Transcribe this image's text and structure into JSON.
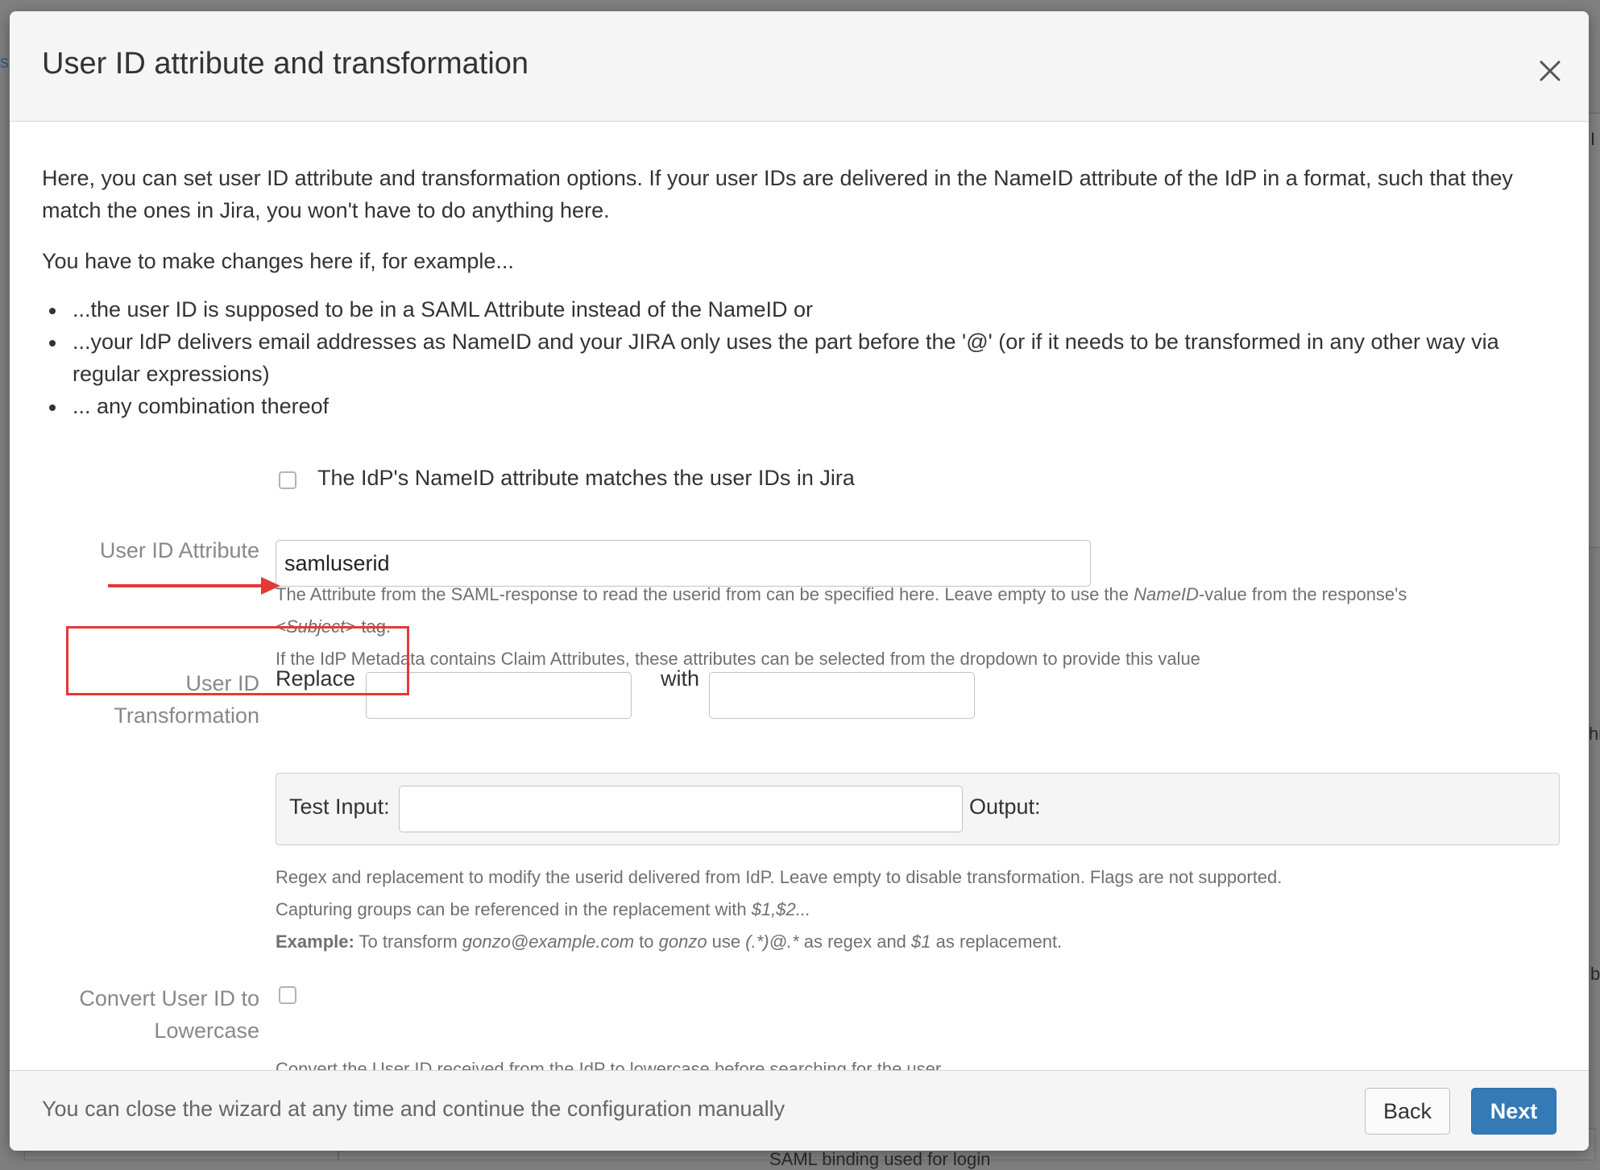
{
  "background": {
    "snippets": [
      "s",
      "I",
      "hi",
      "b",
      "SAML binding used for login"
    ]
  },
  "modal": {
    "title": "User ID attribute and transformation",
    "intro_paragraph": "Here, you can set user ID attribute and transformation options. If your user IDs are delivered in the NameID attribute of the IdP in a format, such that they match the ones in Jira, you won't have to do anything here.",
    "example_lead": "You have to make changes here if, for example...",
    "bullets": [
      "...the user ID is supposed to be in a SAML Attribute instead of the NameID or",
      "...your IdP delivers email addresses as NameID and your JIRA only uses the part before the '@' (or if it needs to be transformed in any other way via regular expressions)",
      "... any combination thereof"
    ],
    "nameid_checkbox": {
      "label": "The IdP's NameID attribute matches the user IDs in Jira",
      "checked": false
    },
    "user_id_attribute": {
      "label": "User ID Attribute",
      "value": "samluserid",
      "help": {
        "line1_pre": "The Attribute from the SAML-response to read the userid from can be specified here. Leave empty to use the ",
        "line1_em": "NameID",
        "line1_post": "-value from the response's",
        "line2_em": "<Subject>",
        "line2_post": "-tag.",
        "line3": "If the IdP Metadata contains Claim Attributes, these attributes can be selected from the dropdown to provide this value"
      }
    },
    "transformation": {
      "label_line1": "User ID",
      "label_line2": "Transformation",
      "replace_label": "Replace",
      "with_label": "with",
      "replace_value": "",
      "with_value": "",
      "test_input_label": "Test Input:",
      "test_input_value": "",
      "output_label": "Output:",
      "help": {
        "line1": "Regex and replacement to modify the userid delivered from IdP. Leave empty to disable transformation. Flags are not supported.",
        "line2_pre": "Capturing groups can be referenced in the replacement with ",
        "line2_em": "$1,$2...",
        "example_label": "Example:",
        "example_t1": " To transform ",
        "example_e1": "gonzo@example.com",
        "example_t2": " to ",
        "example_e2": "gonzo",
        "example_t3": " use ",
        "example_e3": "(.*)@.*",
        "example_t4": " as regex and ",
        "example_e4": "$1",
        "example_t5": " as replacement."
      }
    },
    "lowercase": {
      "label_line1": "Convert User ID to",
      "label_line2": "Lowercase",
      "checked": false,
      "help": "Convert the User ID received from the IdP to lowercase before searching for the user"
    },
    "footer": {
      "note": "You can close the wizard at any time and continue the configuration manually",
      "back_label": "Back",
      "next_label": "Next"
    }
  },
  "colors": {
    "annotation_red": "#e53935",
    "primary_blue": "#337ab7"
  }
}
